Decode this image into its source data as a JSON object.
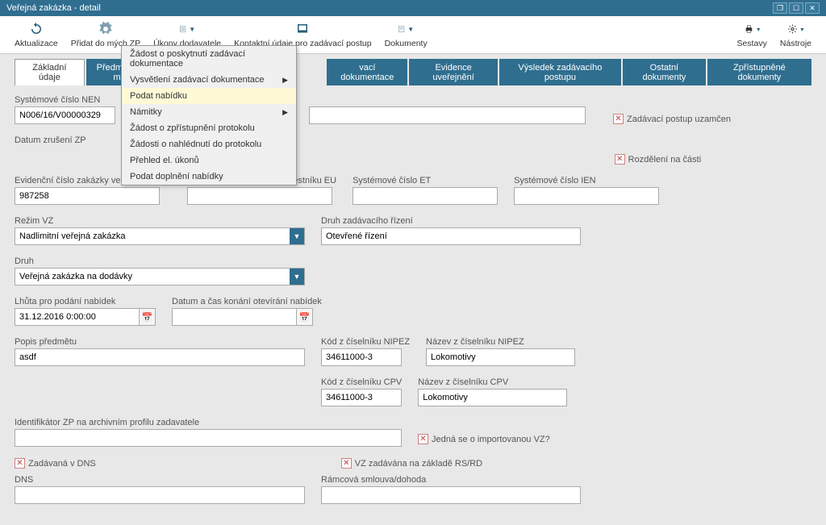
{
  "window": {
    "title": "Veřejná zakázka - detail"
  },
  "toolbar": {
    "aktualizace": "Aktualizace",
    "pridat": "Přidat do mých ZP",
    "ukony": "Úkony dodavatele",
    "kontaktni": "Kontaktní údaje pro zadávací postup",
    "dokumenty": "Dokumenty",
    "sestavy": "Sestavy",
    "nastroje": "Nástroje"
  },
  "menu": {
    "item1": "Žádost o poskytnutí zadávací dokumentace",
    "item2": "Vysvětlení zadávací dokumentace",
    "item3": "Podat nabídku",
    "item4": "Námitky",
    "item5": "Žádost o zpřístupnění protokolu",
    "item6": "Žádosti o nahlédnutí do protokolu",
    "item7": "Přehled el. úkonů",
    "item8": "Podat doplnění nabídky"
  },
  "tabs": {
    "t1": "Základní údaje",
    "t2": "Předmět a m",
    "t3": "vací dokumentace",
    "t4": "Evidence uveřejnění",
    "t5": "Výsledek zadávacího postupu",
    "t6": "Ostatní dokumenty",
    "t7": "Zpřístupněné dokumenty"
  },
  "labels": {
    "sysCisloNEN": "Systémové číslo NEN",
    "datumZruseni": "Datum zrušení ZP",
    "evCisloVestnik": "Evidenční číslo zakázky ve Věstníku VZ",
    "evCisloEU": "Evidenční číslo Úředního věstníku EU",
    "sysCisloET": "Systémové číslo ET",
    "sysCisloIEN": "Systémové číslo IEN",
    "rezimVZ": "Režim VZ",
    "druhRizeni": "Druh zadávacího řízení",
    "druh": "Druh",
    "lhuta": "Lhůta pro podání nabídek",
    "datumCas": "Datum a čas konání otevírání nabídek",
    "popis": "Popis předmětu",
    "kodNIPEZ": "Kód z číselníku NIPEZ",
    "nazevNIPEZ": "Název z číselníku NIPEZ",
    "kodCPV": "Kód z číselníku CPV",
    "nazevCPV": "Název z číselníku CPV",
    "identifikator": "Identifikátor ZP na archivním profilu zadavatele",
    "dns": "DNS",
    "ramcova": "Rámcová smlouva/dohoda"
  },
  "values": {
    "sysCisloNEN": "N006/16/V00000329",
    "evCisloVestnik": "987258",
    "rezimVZ": "Nadlimitní veřejná zakázka",
    "druhRizeni": "Otevřené řízení",
    "druh": "Veřejná zakázka na dodávky",
    "lhuta": "31.12.2016 0:00:00",
    "popis": "asdf",
    "kodNIPEZ": "34611000-3",
    "nazevNIPEZ": "Lokomotivy",
    "kodCPV": "34611000-3",
    "nazevCPV": "Lokomotivy"
  },
  "checks": {
    "postupUzamcen": "Zadávací postup uzamčen",
    "rozdeleni": "Rozdělení na části",
    "importovana": "Jedná se o importovanou VZ?",
    "zadavanaDNS": "Zadávaná v DNS",
    "vzZadavana": "VZ zadávána na základě RS/RD"
  }
}
